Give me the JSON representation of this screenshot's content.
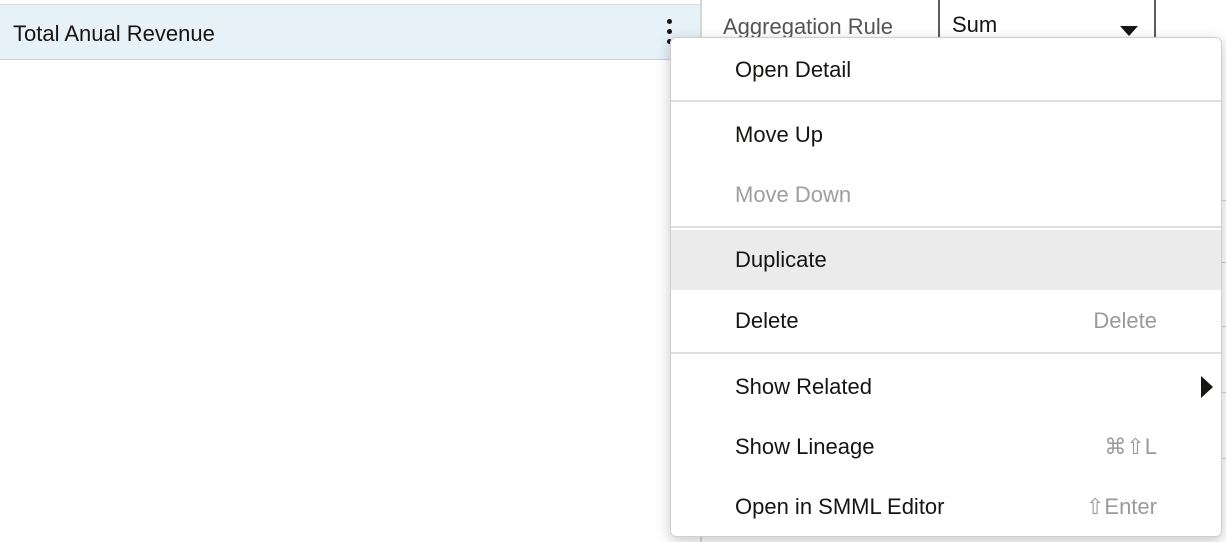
{
  "list": {
    "row_label": "Total Anual Revenue"
  },
  "properties": {
    "aggregation_rule_label": "Aggregation Rule",
    "aggregation_rule_value": "Sum"
  },
  "context_menu": {
    "items": [
      {
        "label": "Open Detail",
        "shortcut": ""
      },
      {
        "label": "Move Up",
        "shortcut": ""
      },
      {
        "label": "Move Down",
        "shortcut": "",
        "disabled": true
      },
      {
        "label": "Duplicate",
        "shortcut": "",
        "highlighted": true
      },
      {
        "label": "Delete",
        "shortcut": "Delete"
      },
      {
        "label": "Show Related",
        "shortcut": "",
        "submenu": true
      },
      {
        "label": "Show Lineage",
        "shortcut": "⌘⇧L"
      },
      {
        "label": "Open in SMML Editor",
        "shortcut": "⇧Enter"
      }
    ]
  },
  "colors": {
    "selected_row_bg": "#e6f1f8",
    "menu_highlight_bg": "#ebebeb",
    "disabled_text": "#9e9e9e",
    "shortcut_text": "#9a9a9a"
  },
  "icons": {
    "row_actions": "kebab-vertical-icon",
    "select_caret": "caret-down-icon",
    "submenu": "caret-right-icon"
  }
}
